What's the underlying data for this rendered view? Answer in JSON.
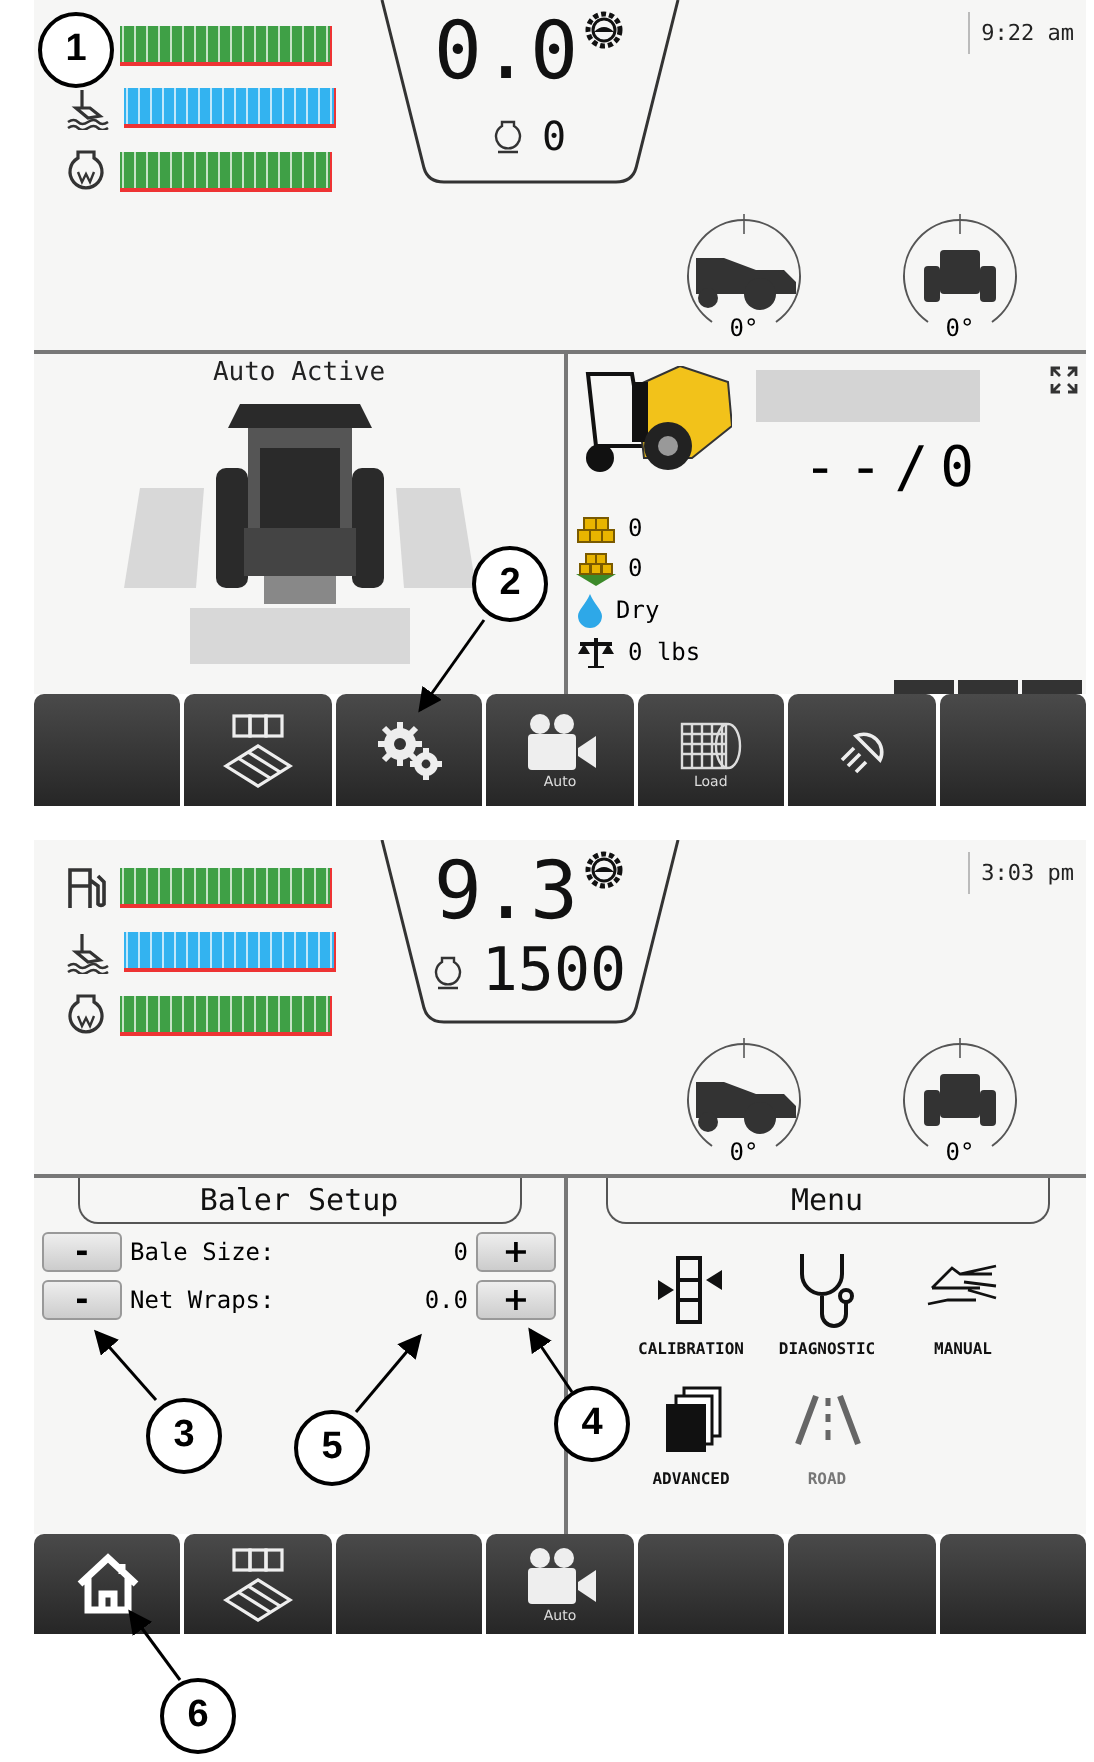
{
  "screens": [
    {
      "gauges": [
        {
          "kind": "none",
          "color": "#3fa046",
          "level": 1
        },
        {
          "kind": "coolant",
          "color": "#33b3f0",
          "level": 1
        },
        {
          "kind": "power",
          "color": "#3fa046",
          "level": 1
        }
      ],
      "speed": "0.0",
      "rpm": "0",
      "time": "9:22 am",
      "angles": [
        "0°",
        "0°"
      ],
      "left_panel": {
        "kind": "status",
        "title": "Auto Active"
      },
      "right_panel": {
        "kind": "bale",
        "reading": "--/0",
        "stats": [
          {
            "kind": "bales",
            "value": "0"
          },
          {
            "kind": "field",
            "value": "0"
          },
          {
            "kind": "moisture",
            "value": "Dry"
          },
          {
            "kind": "weight",
            "value": "0 lbs"
          }
        ]
      },
      "softkeys": [
        {
          "kind": "blank"
        },
        {
          "kind": "counter"
        },
        {
          "kind": "settings"
        },
        {
          "kind": "camera",
          "label": "Auto"
        },
        {
          "kind": "net",
          "label": "Load"
        },
        {
          "kind": "light"
        },
        {
          "kind": "blank"
        }
      ]
    },
    {
      "gauges": [
        {
          "kind": "fuel",
          "color": "#3fa046",
          "level": 1
        },
        {
          "kind": "coolant",
          "color": "#33b3f0",
          "level": 1
        },
        {
          "kind": "power",
          "color": "#3fa046",
          "level": 1
        }
      ],
      "speed": "9.3",
      "rpm": "1500",
      "time": "3:03 pm",
      "angles": [
        "0°",
        "0°"
      ],
      "left_panel": {
        "kind": "setup",
        "title": "Baler Setup",
        "rows": [
          {
            "label": "Bale Size:",
            "value": "0",
            "decrease": "-",
            "increase": "+"
          },
          {
            "label": "Net Wraps:",
            "value": "0.0",
            "decrease": "-",
            "increase": "+"
          }
        ]
      },
      "right_panel": {
        "kind": "menu",
        "title": "Menu",
        "items": [
          {
            "kind": "calibration",
            "label": "CALIBRATION"
          },
          {
            "kind": "diagnostic",
            "label": "DIAGNOSTIC"
          },
          {
            "kind": "manual",
            "label": "MANUAL"
          },
          {
            "kind": "advanced",
            "label": "ADVANCED"
          },
          {
            "kind": "road",
            "label": "ROAD"
          }
        ]
      },
      "softkeys": [
        {
          "kind": "home"
        },
        {
          "kind": "counter"
        },
        {
          "kind": "blank"
        },
        {
          "kind": "camera",
          "label": "Auto"
        },
        {
          "kind": "blank"
        },
        {
          "kind": "blank"
        },
        {
          "kind": "blank"
        }
      ]
    }
  ],
  "callouts": [
    "1",
    "2",
    "3",
    "4",
    "5",
    "6"
  ]
}
